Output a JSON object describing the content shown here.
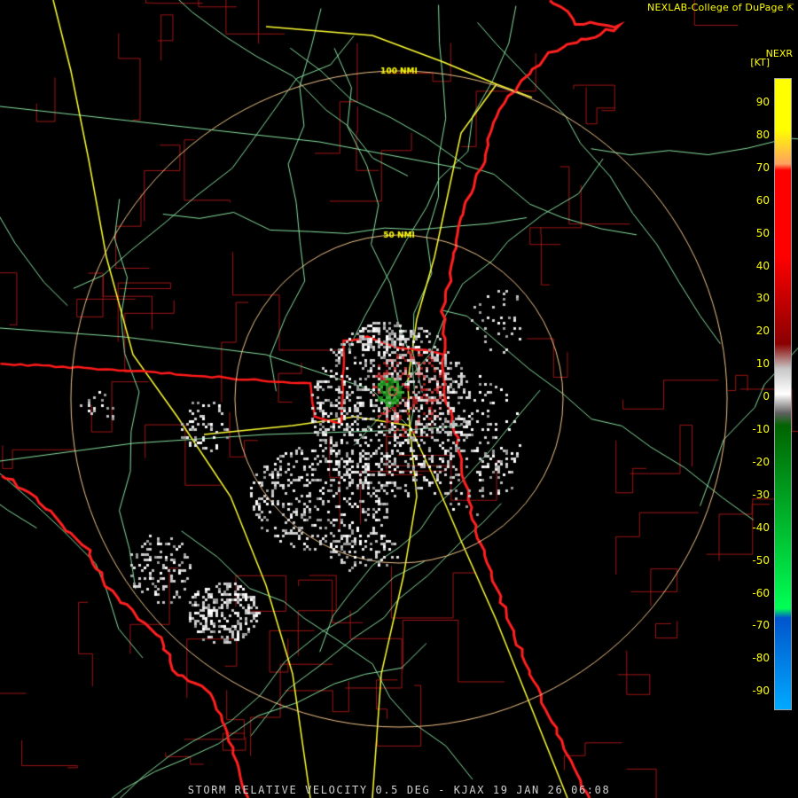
{
  "header": {
    "credit": "NEXLAB-College of DuPage",
    "product_code": "NEXR",
    "units": "[KT]"
  },
  "map": {
    "range_rings": [
      {
        "label": "100 NMI"
      },
      {
        "label": "50 NMI"
      }
    ],
    "colors": {
      "background": "#000000",
      "coast_state_lines": "#ff1a1a",
      "county_lines": "#b01818",
      "highways": "#ffff33",
      "roads": "#88e0a0",
      "range_rings": "#f2c48c",
      "ring_label": "#ffff00"
    }
  },
  "colorbar": {
    "ticks": [
      "90",
      "80",
      "70",
      "60",
      "50",
      "40",
      "30",
      "20",
      "10",
      "0",
      "-10",
      "-20",
      "-30",
      "-40",
      "-50",
      "-60",
      "-70",
      "-80",
      "-90"
    ],
    "colors": [
      "#ffff00",
      "#ffa060",
      "#ff0000",
      "#8a0000",
      "#c8c8c8",
      "#006400",
      "#00ff55",
      "#0055cc",
      "#00aaff"
    ]
  },
  "footer": {
    "caption": "STORM RELATIVE VELOCITY 0.5 DEG - KJAX 19 JAN 26 06:08"
  }
}
